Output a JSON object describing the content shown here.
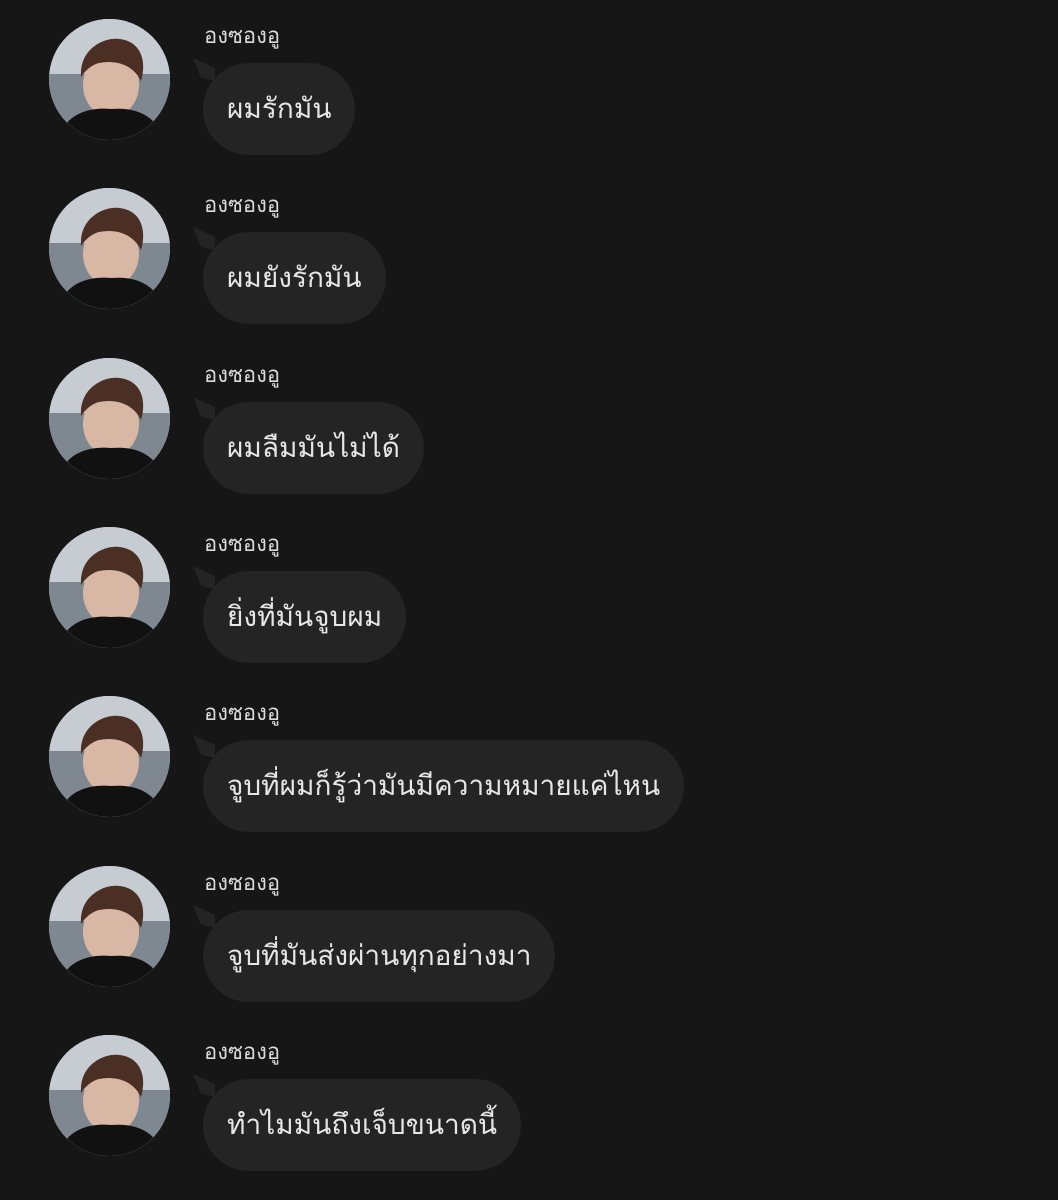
{
  "conversation": {
    "messages": [
      {
        "sender": "องซองอู",
        "text": "ผมรักมัน"
      },
      {
        "sender": "องซองอู",
        "text": "ผมยังรักมัน"
      },
      {
        "sender": "องซองอู",
        "text": "ผมลืมมันไม่ได้"
      },
      {
        "sender": "องซองอู",
        "text": "ยิ่งที่มันจูบผม"
      },
      {
        "sender": "องซองอู",
        "text": "จูบที่ผมก็รู้ว่ามันมีความหมายแค่ไหน"
      },
      {
        "sender": "องซองอู",
        "text": "จูบที่มันส่งผ่านทุกอย่างมา"
      },
      {
        "sender": "องซองอู",
        "text": "ทำไมมันถึงเจ็บขนาดนี้"
      }
    ]
  },
  "theme": {
    "background": "#161616",
    "bubble": "#242424",
    "text": "#e6e6e6",
    "sender_text": "#d9d9d9"
  },
  "icons": {
    "avatar": "profile-photo-avatar"
  }
}
